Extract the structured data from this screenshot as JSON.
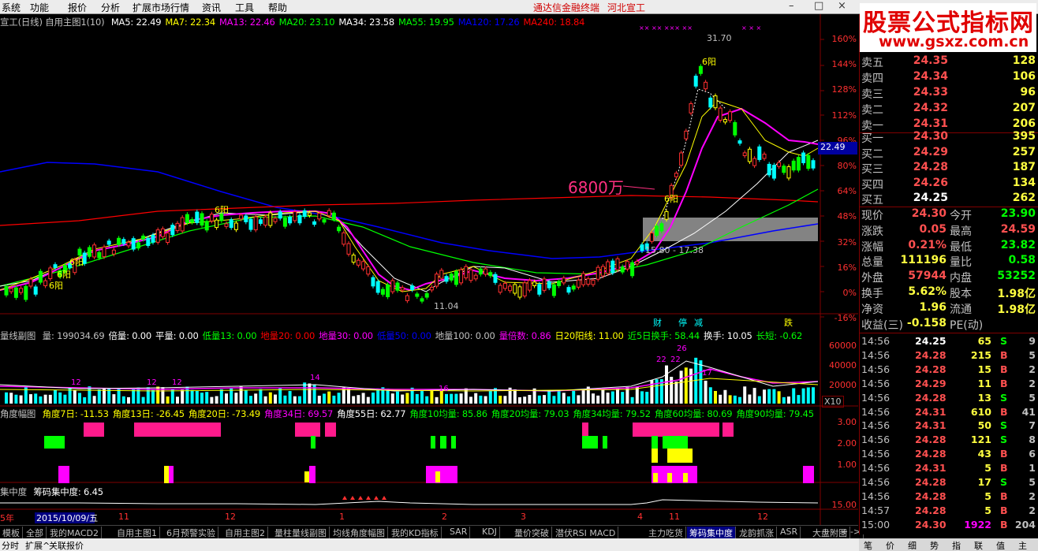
{
  "menu": {
    "items": [
      "系统",
      "功能",
      "报价",
      "分析",
      "扩展市场行情",
      "资讯",
      "工具",
      "帮助"
    ],
    "terminal_title": "通达信金融终端",
    "stock_title": "河北宣工"
  },
  "watermark": {
    "title": "股票公式指标网",
    "url": "www.gsxz.com.cn"
  },
  "main_chart": {
    "header": "宣工(日线) 自用主图1(10)",
    "ma": [
      {
        "label": "MA5: 22.49",
        "color": "#ffffff"
      },
      {
        "label": "MA7: 22.34",
        "color": "#ffff00"
      },
      {
        "label": "MA13: 22.46",
        "color": "#ff00ff"
      },
      {
        "label": "MA20: 23.10",
        "color": "#00ff00"
      },
      {
        "label": "MA34: 23.58",
        "color": "#ffffff"
      },
      {
        "label": "MA55: 19.95",
        "color": "#00ff00"
      },
      {
        "label": "MA120: 17.26",
        "color": "#0000ff"
      },
      {
        "label": "MA240: 18.84",
        "color": "#ff0000"
      }
    ],
    "y_ticks": [
      "160%",
      "144%",
      "128%",
      "112%",
      "96%",
      "80%",
      "64%",
      "48%",
      "32%",
      "16%",
      "0%",
      "-16%"
    ],
    "current_price_tag": "22.49",
    "annotation_big": "6800万",
    "high_label": "31.70",
    "low_label": "11.04",
    "range_label": "15.80 - 17.38",
    "markers_6yang": [
      "6阳",
      "6阳",
      "6阳",
      "6阳",
      "6阳",
      "6阳"
    ],
    "event_tags": [
      {
        "text": "财",
        "color": "#00ffff"
      },
      {
        "text": "停",
        "color": "#00ffff"
      },
      {
        "text": "减",
        "color": "#00ffff"
      },
      {
        "text": "跌",
        "color": "#ffff00"
      }
    ]
  },
  "volume_panel": {
    "title": "量线副图",
    "indicators": [
      {
        "label": "量: 199034.69",
        "color": "#c0c0c0"
      },
      {
        "label": "倍量: 0.00",
        "color": "#ffffff"
      },
      {
        "label": "平量: 0.00",
        "color": "#ffffff"
      },
      {
        "label": "低量13: 0.00",
        "color": "#00ff00"
      },
      {
        "label": "地量20: 0.00",
        "color": "#ff0000"
      },
      {
        "label": "地量30: 0.00",
        "color": "#ff00ff"
      },
      {
        "label": "低量50: 0.00",
        "color": "#0000ff"
      },
      {
        "label": "地量100: 0.00",
        "color": "#c0c0c0"
      },
      {
        "label": "量倍数: 0.86",
        "color": "#ff00ff"
      },
      {
        "label": "日20阳线: 11.00",
        "color": "#ffff00"
      },
      {
        "label": "近5日换手: 58.44",
        "color": "#00ff00"
      },
      {
        "label": "换手: 10.05",
        "color": "#ffffff"
      },
      {
        "label": "长短: -0.62",
        "color": "#00ff00"
      }
    ],
    "y_ticks": [
      "60000",
      "40000",
      "20000"
    ],
    "unit": "X10",
    "bar_labels": [
      "26",
      "22",
      "22",
      "17",
      "16",
      "14",
      "12",
      "12",
      "12"
    ]
  },
  "angle_panel": {
    "title": "角度幅图",
    "indicators": [
      {
        "label": "角度7日: -11.53",
        "color": "#ffff00"
      },
      {
        "label": "角度13日: -26.45",
        "color": "#ffff00"
      },
      {
        "label": "角度20日: -73.49",
        "color": "#ffff00"
      },
      {
        "label": "角度34日: 69.57",
        "color": "#ff00ff"
      },
      {
        "label": "角度55日: 62.77",
        "color": "#ffffff"
      },
      {
        "label": "角度10均量: 85.86",
        "color": "#00ff00"
      },
      {
        "label": "角度20均量: 79.03",
        "color": "#00ff00"
      },
      {
        "label": "角度34均量: 79.52",
        "color": "#00ff00"
      },
      {
        "label": "角度60均量: 80.69",
        "color": "#00ff00"
      },
      {
        "label": "角度90均量: 79.45",
        "color": "#00ff00"
      }
    ],
    "y_ticks": [
      "3.00",
      "2.00",
      "1.00"
    ]
  },
  "chip_panel": {
    "title": "集中度",
    "value_label": "筹码集中度: 6.45",
    "y_tick": "15.00"
  },
  "date_axis": {
    "year": "5年",
    "cursor_date": "2015/10/09/五",
    "months": [
      "11",
      "12",
      "1",
      "2",
      "3",
      "4",
      "11",
      "12"
    ]
  },
  "tabs": [
    {
      "label": "模板",
      "on": false
    },
    {
      "label": "全部",
      "on": false
    },
    {
      "label": "我的MACD2",
      "on": false
    },
    {
      "label": "自用主图1",
      "on": false
    },
    {
      "label": "6月预警实验",
      "on": false
    },
    {
      "label": "自用主图2",
      "on": false
    },
    {
      "label": "量柱量线副图",
      "on": false
    },
    {
      "label": "均线角度幅图",
      "on": false
    },
    {
      "label": "我的KD指标",
      "on": false
    },
    {
      "label": "SAR",
      "on": false
    },
    {
      "label": "KDJ",
      "on": false
    },
    {
      "label": "量价突破",
      "on": false
    },
    {
      "label": "潜伏RSI MACD",
      "on": false
    },
    {
      "label": "主力吃货",
      "on": false
    },
    {
      "label": "筹码集中度",
      "on": true
    },
    {
      "label": "龙韵抓涨",
      "on": false
    },
    {
      "label": "ASR",
      "on": false
    },
    {
      "label": "大盘附图",
      "on": false
    },
    {
      "label": ">",
      "on": false
    }
  ],
  "tab_controls": [
    "+",
    "-",
    "+",
    "-"
  ],
  "bottom_tabs": [
    "分时",
    "扩展^",
    "关联报价"
  ],
  "quote": {
    "sell": [
      {
        "label": "卖五",
        "price": "24.35",
        "vol": "128"
      },
      {
        "label": "卖四",
        "price": "24.34",
        "vol": "106"
      },
      {
        "label": "卖三",
        "price": "24.33",
        "vol": "96"
      },
      {
        "label": "卖二",
        "price": "24.32",
        "vol": "207"
      },
      {
        "label": "卖一",
        "price": "24.31",
        "vol": "206"
      }
    ],
    "buy": [
      {
        "label": "买一",
        "price": "24.30",
        "vol": "395"
      },
      {
        "label": "买二",
        "price": "24.29",
        "vol": "257"
      },
      {
        "label": "买三",
        "price": "24.28",
        "vol": "187"
      },
      {
        "label": "买四",
        "price": "24.26",
        "vol": "134"
      },
      {
        "label": "买五",
        "price": "24.25",
        "vol": "262"
      }
    ],
    "stats": [
      {
        "l1": "现价",
        "v1": "24.30",
        "c1": "#ff5050",
        "l2": "今开",
        "v2": "23.90",
        "c2": "#00ff00"
      },
      {
        "l1": "涨跌",
        "v1": "0.05",
        "c1": "#ff5050",
        "l2": "最高",
        "v2": "24.59",
        "c2": "#ff5050"
      },
      {
        "l1": "涨幅",
        "v1": "0.21%",
        "c1": "#ff5050",
        "l2": "最低",
        "v2": "23.82",
        "c2": "#00ff00"
      },
      {
        "l1": "总量",
        "v1": "111196",
        "c1": "#ffff40",
        "l2": "量比",
        "v2": "0.58",
        "c2": "#00ff00"
      },
      {
        "l1": "外盘",
        "v1": "57944",
        "c1": "#ff5050",
        "l2": "内盘",
        "v2": "53252",
        "c2": "#00ff00"
      },
      {
        "l1": "换手",
        "v1": "5.62%",
        "c1": "#ffff40",
        "l2": "股本",
        "v2": "1.98亿",
        "c2": "#ffff40"
      },
      {
        "l1": "净资",
        "v1": "1.96",
        "c1": "#ffff40",
        "l2": "流通",
        "v2": "1.98亿",
        "c2": "#ffff40"
      },
      {
        "l1": "收益(三)",
        "v1": "-0.158",
        "c1": "#ffff40",
        "l2": "PE(动)",
        "v2": "",
        "c2": "#ffff40"
      }
    ],
    "ticks": [
      {
        "t": "14:56",
        "p": "24.25",
        "pc": "#ffffff",
        "v": "65",
        "s": "S",
        "n": "9"
      },
      {
        "t": "14:56",
        "p": "24.28",
        "pc": "#ff5050",
        "v": "215",
        "s": "B",
        "n": "5"
      },
      {
        "t": "14:56",
        "p": "24.28",
        "pc": "#ff5050",
        "v": "15",
        "s": "B",
        "n": "2"
      },
      {
        "t": "14:56",
        "p": "24.29",
        "pc": "#ff5050",
        "v": "11",
        "s": "B",
        "n": "2"
      },
      {
        "t": "14:56",
        "p": "24.28",
        "pc": "#ff5050",
        "v": "13",
        "s": "S",
        "n": "5"
      },
      {
        "t": "14:56",
        "p": "24.31",
        "pc": "#ff5050",
        "v": "610",
        "s": "B",
        "n": "41"
      },
      {
        "t": "14:56",
        "p": "24.31",
        "pc": "#ff5050",
        "v": "50",
        "s": "S",
        "n": "7"
      },
      {
        "t": "14:56",
        "p": "24.28",
        "pc": "#ff5050",
        "v": "121",
        "s": "S",
        "n": "8"
      },
      {
        "t": "14:56",
        "p": "24.28",
        "pc": "#ff5050",
        "v": "43",
        "s": "B",
        "n": "6"
      },
      {
        "t": "14:56",
        "p": "24.31",
        "pc": "#ff5050",
        "v": "5",
        "s": "B",
        "n": "1"
      },
      {
        "t": "14:56",
        "p": "24.28",
        "pc": "#ff5050",
        "v": "17",
        "s": "S",
        "n": "5"
      },
      {
        "t": "14:56",
        "p": "24.28",
        "pc": "#ff5050",
        "v": "5",
        "s": "B",
        "n": "2"
      },
      {
        "t": "14:57",
        "p": "24.28",
        "pc": "#ff5050",
        "v": "5",
        "s": "B",
        "n": "2"
      },
      {
        "t": "15:00",
        "p": "24.30",
        "pc": "#ff5050",
        "v": "1922",
        "s": "B",
        "n": "204"
      }
    ]
  },
  "right_tabs": [
    "笔",
    "价",
    "细",
    "势",
    "指",
    "联",
    "值",
    "主"
  ]
}
